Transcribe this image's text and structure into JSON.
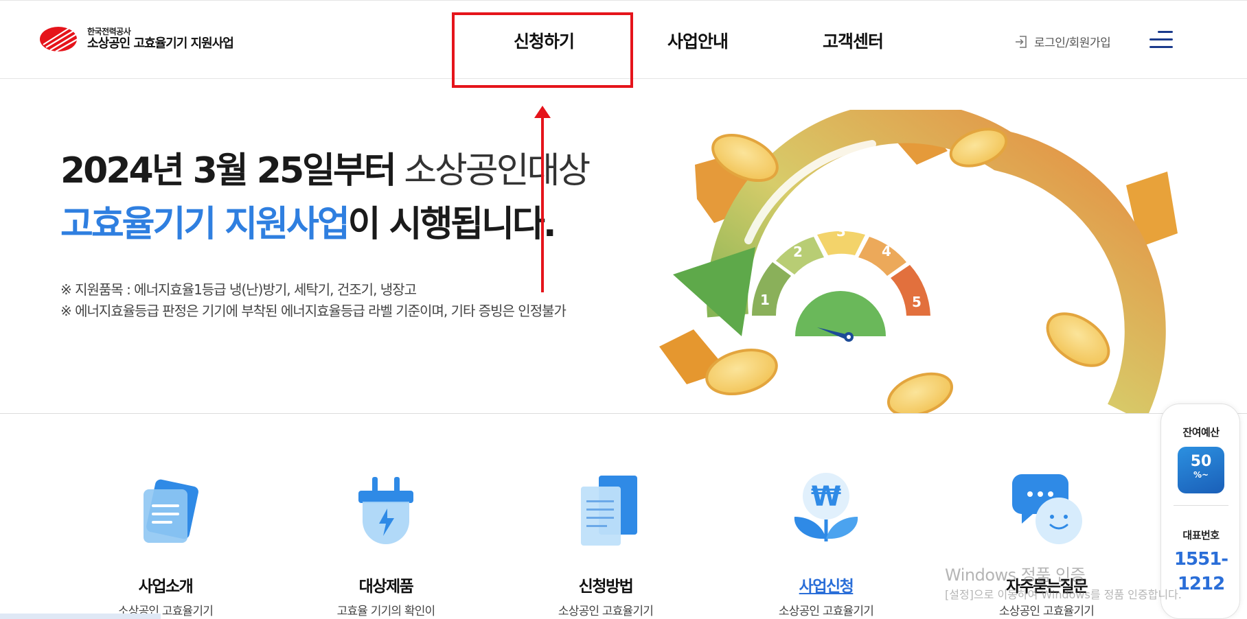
{
  "header": {
    "org": "한국전력공사",
    "title": "소상공인 고효율기기 지원사업",
    "nav": [
      "신청하기",
      "사업안내",
      "고객센터"
    ],
    "login": "로그인/회원가입",
    "icons": {
      "logo": "kepco-logo-icon",
      "login": "login-icon",
      "menu": "hamburger-menu-icon"
    }
  },
  "hero": {
    "line1_bold": "2024년 3월 25일부터",
    "line1_light": " 소상공인대상",
    "line2_blue": "고효율기기 지원사업",
    "line2_rest": "이 시행됩니다.",
    "note1": "※ 지원품목 : 에너지효율1등급 냉(난)방기, 세탁기, 건조기, 냉장고",
    "note2": "※ 에너지효율등급 판정은 기기에 부착된 에너지효율등급 라벨 기준이며, 기타 증빙은 인정불가",
    "gauge_labels": [
      "1",
      "2",
      "3",
      "4",
      "5"
    ]
  },
  "quick_links": [
    {
      "title": "사업소개",
      "sub": "소상공인 고효율기기",
      "icon": "document-icon"
    },
    {
      "title": "대상제품",
      "sub": "고효율 기기의 확인이",
      "icon": "plug-icon"
    },
    {
      "title": "신청방법",
      "sub": "소상공인 고효율기기",
      "icon": "file-list-icon"
    },
    {
      "title": "사업신청",
      "sub": "소상공인 고효율기기",
      "icon": "won-plant-icon"
    },
    {
      "title": "자주묻는질문",
      "sub": "소상공인 고효율기기",
      "icon": "chat-smile-icon"
    }
  ],
  "side": {
    "budget_label": "잔여예산",
    "budget_value": "50",
    "budget_unit": "%~",
    "phone_label": "대표번호",
    "phone_line1": "1551-",
    "phone_line2": "1212"
  },
  "watermark": {
    "title": "Windows 정품 인증",
    "sub": "[설정]으로 이동하여 Windows를 정품 인증합니다."
  },
  "colors": {
    "accent_blue": "#2f7fe0",
    "highlight_red": "#e5141b",
    "link_blue": "#2a6ed8"
  }
}
